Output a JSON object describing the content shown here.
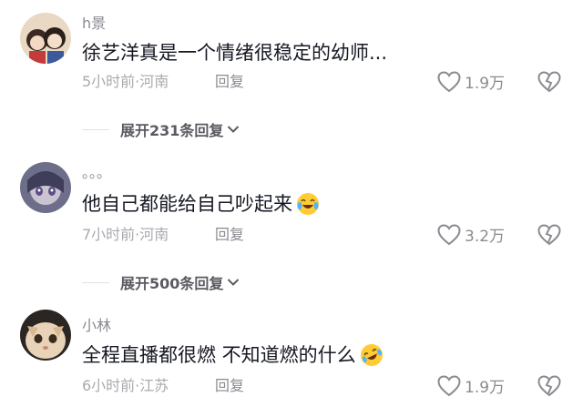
{
  "comments": [
    {
      "username": "h景",
      "text": "徐艺洋真是一个情绪很稳定的幼师...",
      "meta": "5小时前·河南",
      "reply_label": "回复",
      "likes": "1.9万",
      "expand_label": "展开231条回复"
    },
    {
      "username": "。。。",
      "text": "他自己都能给自己吵起来",
      "meta": "7小时前·河南",
      "reply_label": "回复",
      "likes": "3.2万",
      "expand_label": "展开500条回复"
    },
    {
      "username": "小林",
      "text": "全程直播都很燃 不知道燃的什么",
      "meta": "6小时前·江苏",
      "reply_label": "回复",
      "likes": "1.9万"
    }
  ],
  "icons": {
    "like": "heart-outline-icon",
    "dislike": "broken-heart-icon",
    "expand": "chevron-down-icon",
    "emoji_1": "laughing-crying-emoji",
    "emoji_2": "rolling-laughing-emoji"
  },
  "colors": {
    "text": "#161823",
    "secondary": "#8a8b91",
    "meta": "#a9aab0",
    "divider": "#e3e3e5"
  }
}
